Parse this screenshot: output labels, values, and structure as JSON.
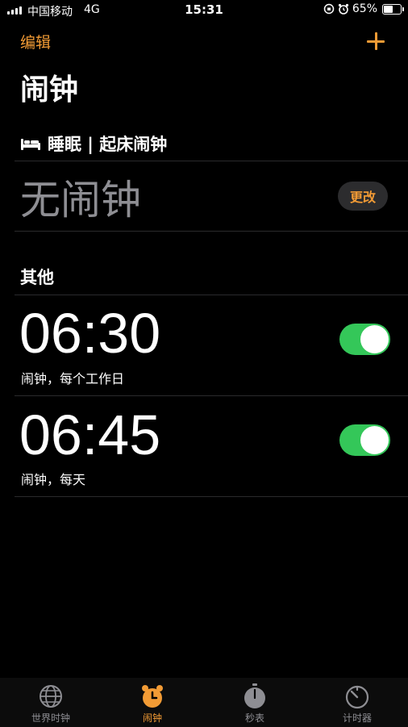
{
  "status_bar": {
    "carrier": "中国移动",
    "network": "4G",
    "time": "15:31",
    "battery_text": "65%",
    "battery_level": 0.65
  },
  "nav": {
    "edit_label": "编辑",
    "add_icon": "plus-icon"
  },
  "page_title": "闹钟",
  "sleep": {
    "header": "睡眠 | 起床闹钟",
    "icon": "bed-icon",
    "no_alarm": "无闹钟",
    "change_label": "更改"
  },
  "other": {
    "header": "其他",
    "alarms": [
      {
        "time": "06:30",
        "label": "闹钟，每个工作日",
        "enabled": true
      },
      {
        "time": "06:45",
        "label": "闹钟，每天",
        "enabled": true
      }
    ]
  },
  "tabs": [
    {
      "label": "世界时钟",
      "icon": "globe-icon",
      "active": false
    },
    {
      "label": "闹钟",
      "icon": "alarm-clock-icon",
      "active": true
    },
    {
      "label": "秒表",
      "icon": "stopwatch-icon",
      "active": false
    },
    {
      "label": "计时器",
      "icon": "timer-icon",
      "active": false
    }
  ],
  "colors": {
    "accent": "#f29b35",
    "toggle_on": "#34c759",
    "secondary_text": "#8e8e93",
    "background": "#000000"
  }
}
